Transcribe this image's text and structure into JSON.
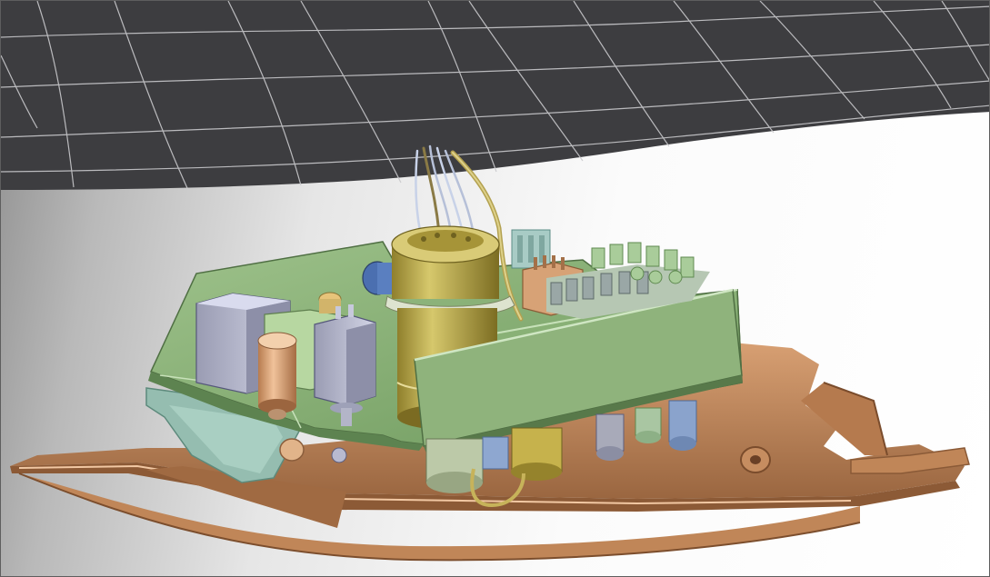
{
  "viewport": {
    "background_colors": [
      "#8e8e8e",
      "#ffffff"
    ],
    "mesh_surface_color": "#3d3d40",
    "mesh_line_color": "#c9c9cc"
  },
  "model": {
    "base_plate_color": "#c48a5e",
    "pcb_color": "#8fb37c",
    "cylinder_color": "#b9a84c",
    "relay_color": "#aeb1c8",
    "bracket_color": "#95bdb0",
    "capacitor_color": "#d8a275"
  },
  "icons": [
    "mesh-surface-icon",
    "cad-assembly-icon"
  ]
}
